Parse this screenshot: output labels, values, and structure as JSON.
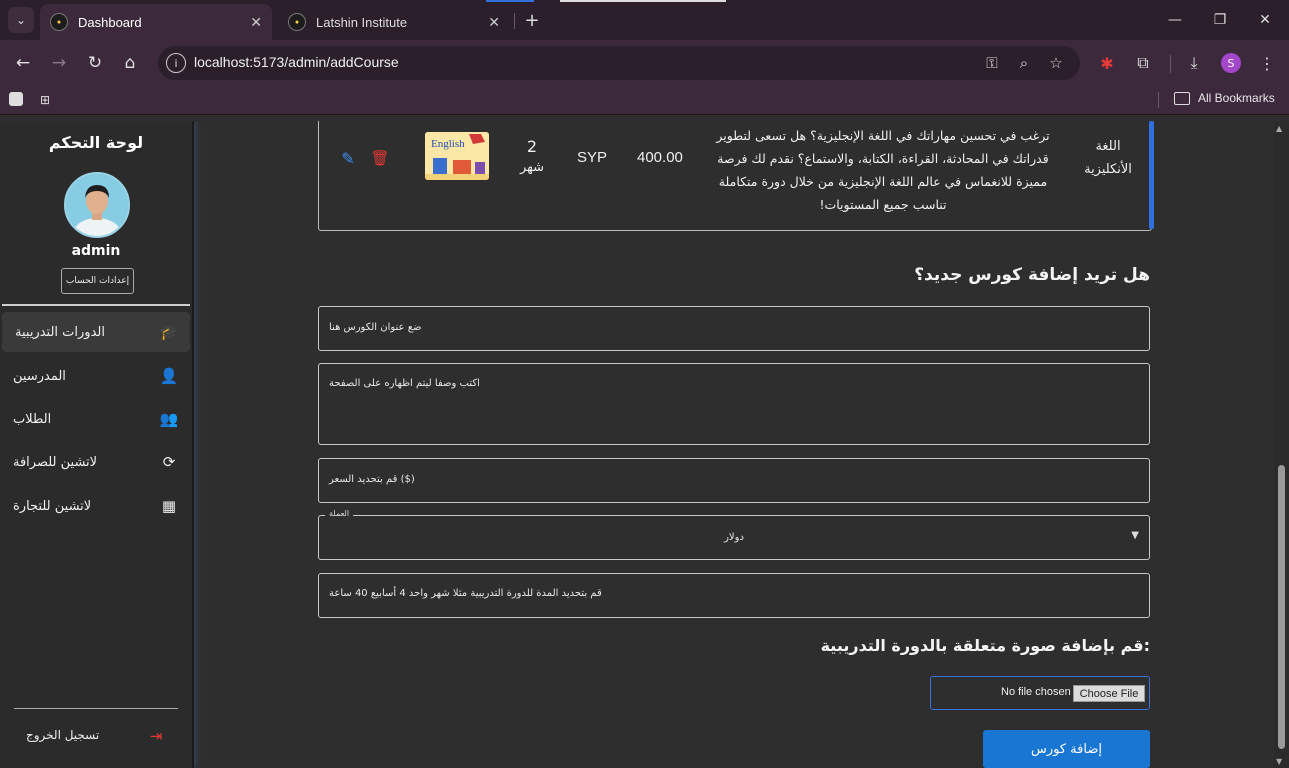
{
  "browser": {
    "tabs": [
      {
        "title": "Dashboard",
        "active": true
      },
      {
        "title": "Latshin Institute",
        "active": false
      }
    ],
    "url": "localhost:5173/admin/addCourse",
    "profile_initial": "S",
    "bookmarks_label": "All Bookmarks",
    "tab_close_glyph": "✕",
    "new_tab_glyph": "+",
    "minimize_glyph": "—",
    "restore_glyph": "❐",
    "close_glyph": "✕"
  },
  "sidebar": {
    "title": "لوحة التحكم",
    "username": "admin",
    "account_settings": "إعدادات الحساب",
    "items": [
      {
        "label": "الدورات التدريبية",
        "icon": "graduation-cap-icon",
        "glyph": "🎓"
      },
      {
        "label": "المدرسين",
        "icon": "person-icon",
        "glyph": "👤"
      },
      {
        "label": "الطلاب",
        "icon": "people-icon",
        "glyph": "👥"
      },
      {
        "label": "لاتشين للصرافة",
        "icon": "currency-exchange-icon",
        "glyph": "⟳"
      },
      {
        "label": "لاتشين للتجارة",
        "icon": "building-icon",
        "glyph": "▦"
      }
    ],
    "logout": "تسجيل الخروج",
    "logout_glyph": "⇥"
  },
  "course_row": {
    "name": "اللغة الأنكليزية",
    "description": "ترغب في تحسين مهاراتك في اللغة الإنجليزية؟ هل تسعى لتطوير قدراتك في المحادثة، القراءة، الكتابة، والاستماع؟ نقدم لك فرصة مميزة للانغماس في عالم اللغة الإنجليزية من خلال دورة متكاملة تناسب جميع المستويات!",
    "price": "400.00",
    "currency": "SYP",
    "duration_number": "2",
    "duration_unit": "شهر",
    "thumbnail_text": "English",
    "edit_glyph": "✎",
    "delete_glyph": "🗑"
  },
  "form": {
    "heading": "هل تريد إضافة كورس جديد؟",
    "title_placeholder": "ضع عنوان الكورس هنا",
    "description_placeholder": "اكتب وصفا ليتم اظهاره على الصفحة",
    "price_placeholder": "قم بتحديد السعر ($)",
    "currency_label": "العملة",
    "currency_value": "دولار",
    "duration_placeholder": "قم بتحديد المدة للدورة التدريبية مثلا شهر واحد 4 أسابيع 40 ساعة",
    "image_heading": ":قم بإضافة صورة متعلقة بالدورة التدريبية",
    "no_file": "No file chosen",
    "choose_file": "Choose File",
    "submit": "إضافة كورس"
  },
  "colors": {
    "accent": "#1976d2",
    "delete": "#e53935",
    "edit": "#3b8eea",
    "page_bg": "#2e2e2e",
    "chrome_bg": "#3c2a3c"
  }
}
